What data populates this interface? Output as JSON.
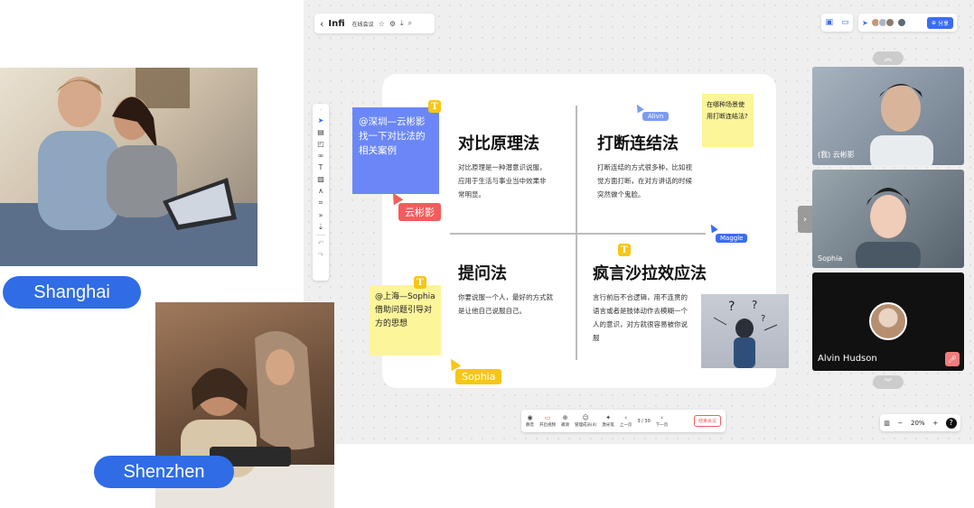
{
  "canvas": {
    "board_title": "Infi",
    "meeting_label": "在线会议",
    "share_label": "分享"
  },
  "quadrants": [
    {
      "title": "对比原理法",
      "body": "对比原理是一种潜意识说服，应用于生活与事业当中效果非常明显。"
    },
    {
      "title": "打断连结法",
      "body": "打断连结的方式很多种，比如视觉方面打断，在对方讲话的时候突然做个鬼脸。"
    },
    {
      "title": "提问法",
      "body": "你要说服一个人，最好的方式就是让他自己说服自己。"
    },
    {
      "title": "疯言沙拉效应法",
      "body": "言行前后不合逻辑，用不连贯的语言或者是肢体动作去模糊一个人的意识，对方就很容易被你说服"
    }
  ],
  "notes": {
    "blue": "@深圳—云彬影 找一下对比法的相关案例",
    "yellow_top": "在哪种场景使用打断连结法?",
    "yellow_bottom": "@上海—Sophia 借助问题引导对方的思想"
  },
  "cursors": {
    "red": "云彬影",
    "yellow": "Sophia",
    "blue_a": "Alivn",
    "blue_m": "Maggle"
  },
  "videos": [
    {
      "label": "(我) 云彬影"
    },
    {
      "label": "Sophia"
    },
    {
      "label": "Alvin Hudson"
    }
  ],
  "bottombar": {
    "items": [
      "静音",
      "开启视频",
      "邀请",
      "管理成员(4)",
      "激光笔",
      "上一页"
    ],
    "page": "3 / 30",
    "next": "下一页",
    "end": "结束会议"
  },
  "zoom": "20%",
  "cities": {
    "left_top": "Shanghai",
    "left_bottom": "Shenzhen"
  },
  "colors": {
    "accent": "#2f6ce6",
    "note_blue": "#6b87f7",
    "note_yellow": "#fdf59a",
    "cursor_red": "#f25c5c",
    "cursor_yellow": "#f7c615"
  }
}
